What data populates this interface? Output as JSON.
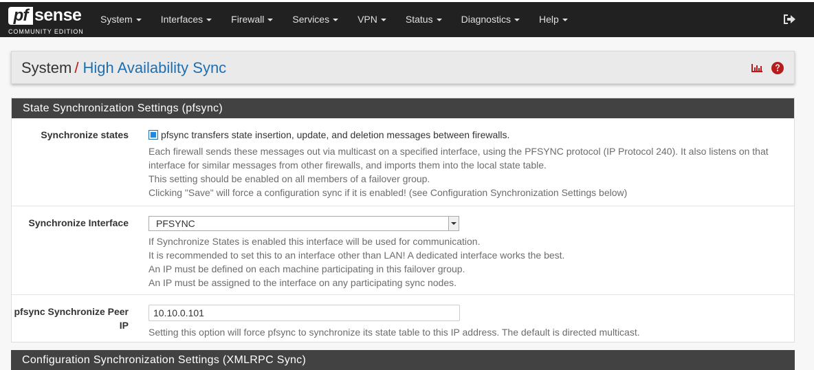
{
  "brand": {
    "logo_pf": "pf",
    "logo_sense": "sense",
    "edition": "COMMUNITY EDITION"
  },
  "nav": {
    "items": [
      {
        "label": "System"
      },
      {
        "label": "Interfaces"
      },
      {
        "label": "Firewall"
      },
      {
        "label": "Services"
      },
      {
        "label": "VPN"
      },
      {
        "label": "Status"
      },
      {
        "label": "Diagnostics"
      },
      {
        "label": "Help"
      }
    ],
    "logout_icon": "sign-out-icon"
  },
  "breadcrumb": {
    "root": "System",
    "separator": "/",
    "current": "High Availability Sync",
    "icons": [
      "bar-chart-icon",
      "help-circle-icon"
    ]
  },
  "state_sync": {
    "title": "State Synchronization Settings (pfsync)",
    "sync_states": {
      "label": "Synchronize states",
      "checked": true,
      "checkbox_label": "pfsync transfers state insertion, update, and deletion messages between firewalls.",
      "help": [
        "Each firewall sends these messages out via multicast on a specified interface, using the PFSYNC protocol (IP Protocol 240). It also listens on that",
        "interface for similar messages from other firewalls, and imports them into the local state table.",
        "This setting should be enabled on all members of a failover group.",
        "Clicking \"Save\" will force a configuration sync if it is enabled! (see Configuration Synchronization Settings below)"
      ]
    },
    "sync_interface": {
      "label": "Synchronize Interface",
      "value": "PFSYNC",
      "help": [
        "If Synchronize States is enabled this interface will be used for communication.",
        "It is recommended to set this to an interface other than LAN! A dedicated interface works the best.",
        "An IP must be defined on each machine participating in this failover group.",
        "An IP must be assigned to the interface on any participating sync nodes."
      ]
    },
    "sync_peer": {
      "label_line1": "pfsync Synchronize Peer",
      "label_line2": "IP",
      "value": "10.10.0.101",
      "help": "Setting this option will force pfsync to synchronize its state table to this IP address. The default is directed multicast."
    }
  },
  "config_sync": {
    "title": "Configuration Synchronization Settings (XMLRPC Sync)"
  },
  "colors": {
    "navbar": "#212121",
    "panel_header": "#424242",
    "accent_blue": "#1e6fb2",
    "accent_red": "#b71c1c"
  }
}
